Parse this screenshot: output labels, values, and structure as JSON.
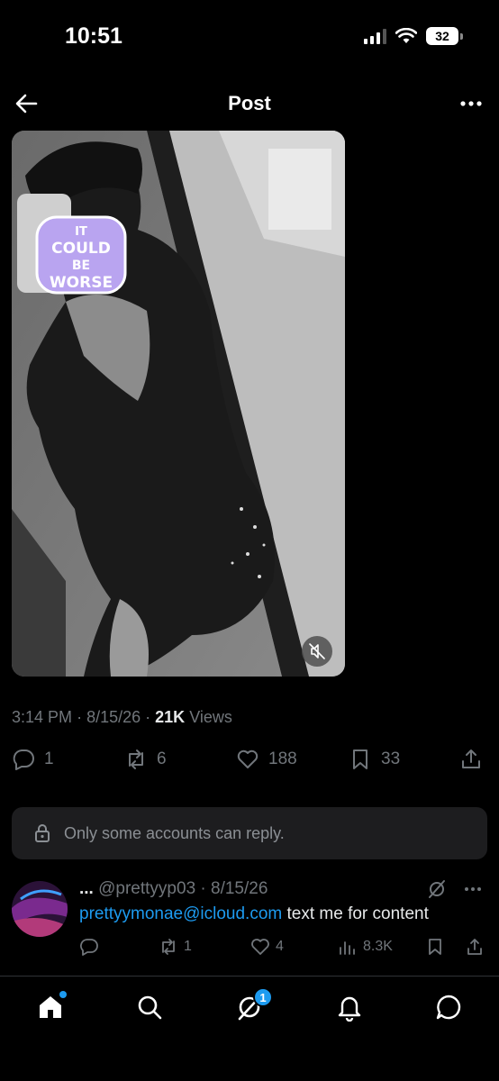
{
  "status": {
    "time": "10:51",
    "battery": "32"
  },
  "header": {
    "title": "Post"
  },
  "media": {
    "sticker_text": [
      "IT",
      "COULD",
      "BE",
      "WORSE"
    ]
  },
  "meta": {
    "time": "3:14 PM",
    "date": "8/15/26",
    "views_count": "21K",
    "views_label": "Views"
  },
  "actions": {
    "replies": "1",
    "reposts": "6",
    "likes": "188",
    "bookmarks": "33"
  },
  "reply_restriction": "Only some accounts can reply.",
  "reply": {
    "name": "...",
    "handle_date": "@prettyyp03 · 8/15/26",
    "link": "prettyymonae@icloud.com",
    "text": " text me for content",
    "reposts": "1",
    "likes": "4",
    "views": "8.3K"
  },
  "nav": {
    "notifications_badge": "1"
  },
  "colors": {
    "accent": "#1d9bf0",
    "muted": "#71767b",
    "background": "#000000"
  }
}
